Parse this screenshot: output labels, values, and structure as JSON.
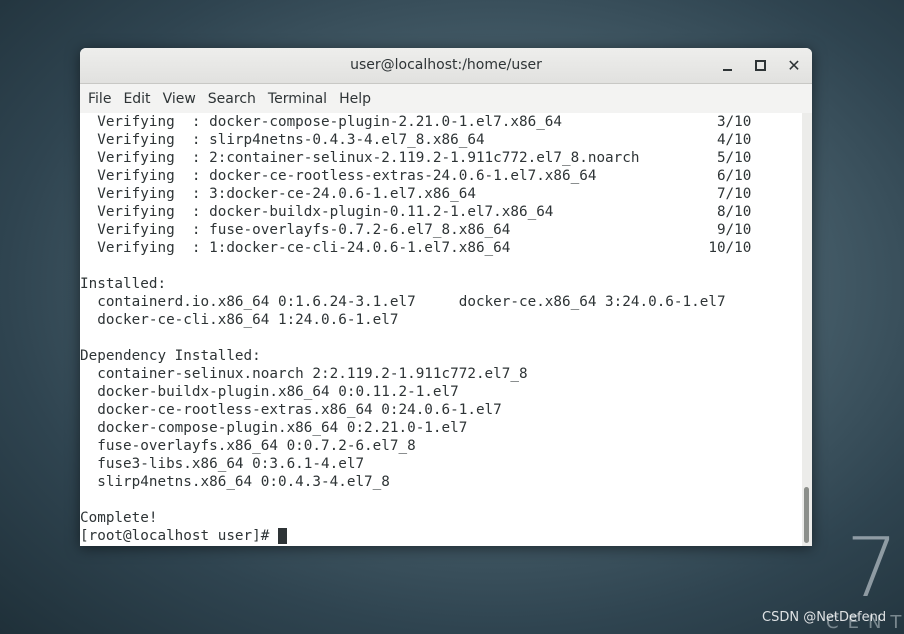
{
  "desktop": {
    "version_numeral": "7",
    "brand_word": "CENTOS",
    "watermark": "CSDN @NetDefend"
  },
  "window": {
    "title": "user@localhost:/home/user",
    "controls": {
      "minimize_icon": "minimize-icon",
      "maximize_icon": "maximize-icon",
      "close_icon": "close-icon"
    }
  },
  "menubar": {
    "items": [
      "File",
      "Edit",
      "View",
      "Search",
      "Terminal",
      "Help"
    ]
  },
  "terminal": {
    "lines": [
      "  Verifying  : docker-compose-plugin-2.21.0-1.el7.x86_64                  3/10",
      "  Verifying  : slirp4netns-0.4.3-4.el7_8.x86_64                           4/10",
      "  Verifying  : 2:container-selinux-2.119.2-1.911c772.el7_8.noarch         5/10",
      "  Verifying  : docker-ce-rootless-extras-24.0.6-1.el7.x86_64              6/10",
      "  Verifying  : 3:docker-ce-24.0.6-1.el7.x86_64                            7/10",
      "  Verifying  : docker-buildx-plugin-0.11.2-1.el7.x86_64                   8/10",
      "  Verifying  : fuse-overlayfs-0.7.2-6.el7_8.x86_64                        9/10",
      "  Verifying  : 1:docker-ce-cli-24.0.6-1.el7.x86_64                       10/10",
      "",
      "Installed:",
      "  containerd.io.x86_64 0:1.6.24-3.1.el7     docker-ce.x86_64 3:24.0.6-1.el7",
      "  docker-ce-cli.x86_64 1:24.0.6-1.el7",
      "",
      "Dependency Installed:",
      "  container-selinux.noarch 2:2.119.2-1.911c772.el7_8",
      "  docker-buildx-plugin.x86_64 0:0.11.2-1.el7",
      "  docker-ce-rootless-extras.x86_64 0:24.0.6-1.el7",
      "  docker-compose-plugin.x86_64 0:2.21.0-1.el7",
      "  fuse-overlayfs.x86_64 0:0.7.2-6.el7_8",
      "  fuse3-libs.x86_64 0:3.6.1-4.el7",
      "  slirp4netns.x86_64 0:0.4.3-4.el7_8",
      "",
      "Complete!"
    ],
    "prompt": "[root@localhost user]# "
  },
  "colors": {
    "terminal_fg": "#2e3436",
    "terminal_bg": "#ffffff",
    "titlebar_bg": "#e8e8e7"
  }
}
